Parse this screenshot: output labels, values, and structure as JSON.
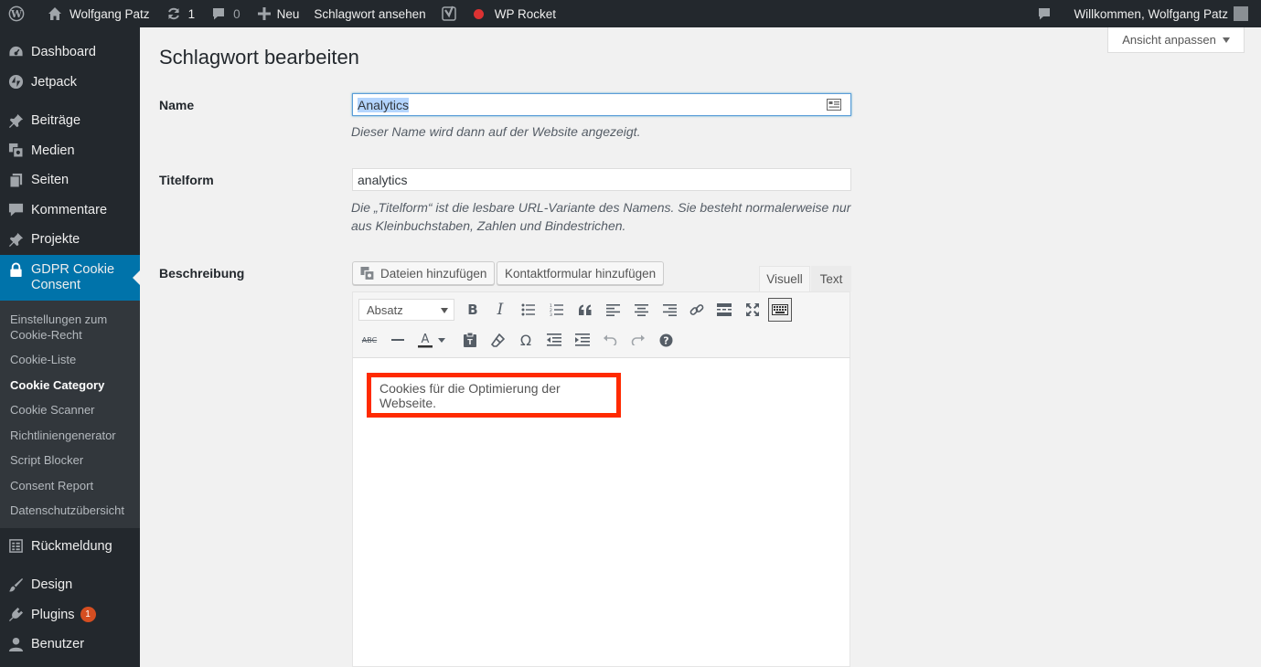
{
  "admin_bar": {
    "site_name": "Wolfgang Patz",
    "updates_count": "1",
    "comments_count": "0",
    "new_label": "Neu",
    "view_tag_label": "Schlagwort ansehen",
    "rocket_label": "WP Rocket",
    "greeting": "Willkommen, Wolfgang Patz"
  },
  "sidebar": {
    "items_top": [
      {
        "label": "Dashboard",
        "icon": "dashboard-icon"
      },
      {
        "label": "Jetpack",
        "icon": "jetpack-icon"
      }
    ],
    "items_mid": [
      {
        "label": "Beiträge",
        "icon": "pin-icon"
      },
      {
        "label": "Medien",
        "icon": "media-icon"
      },
      {
        "label": "Seiten",
        "icon": "pages-icon"
      },
      {
        "label": "Kommentare",
        "icon": "comments-icon"
      },
      {
        "label": "Projekte",
        "icon": "pin-icon"
      }
    ],
    "active": {
      "label": "GDPR Cookie Consent",
      "icon": "lock-icon"
    },
    "submenu": [
      "Einstellungen zum Cookie-Recht",
      "Cookie-Liste",
      "Cookie Category",
      "Cookie Scanner",
      "Richtliniengenerator",
      "Script Blocker",
      "Consent Report",
      "Datenschutzübersicht"
    ],
    "current_sub_index": 2,
    "feedback": {
      "label": "Rückmeldung",
      "icon": "feedback-icon"
    },
    "items_bottom": [
      {
        "label": "Design",
        "icon": "brush-icon"
      },
      {
        "label": "Plugins",
        "icon": "plugin-icon",
        "badge": "1"
      },
      {
        "label": "Benutzer",
        "icon": "user-icon"
      }
    ]
  },
  "main": {
    "screen_options": "Ansicht anpassen",
    "title": "Schlagwort bearbeiten",
    "name_label": "Name",
    "name_value": "Analytics",
    "name_desc": "Dieser Name wird dann auf der Website angezeigt.",
    "slug_label": "Titelform",
    "slug_value": "analytics",
    "slug_desc": "Die „Titelform“ ist die lesbare URL-Variante des Namens. Sie besteht normalerweise nur aus Kleinbuchstaben, Zahlen und Bindestrichen.",
    "desc_label": "Beschreibung",
    "add_media": "Dateien hinzufügen",
    "add_form": "Kontaktformular hinzufügen",
    "tab_visual": "Visuell",
    "tab_text": "Text",
    "format_select": "Absatz",
    "content": "Cookies für die Optimierung der Webseite."
  },
  "colors": {
    "admin_bg": "#23282d",
    "accent": "#0073aa",
    "highlight_border": "#ff2a00",
    "badge": "#d54e21"
  }
}
